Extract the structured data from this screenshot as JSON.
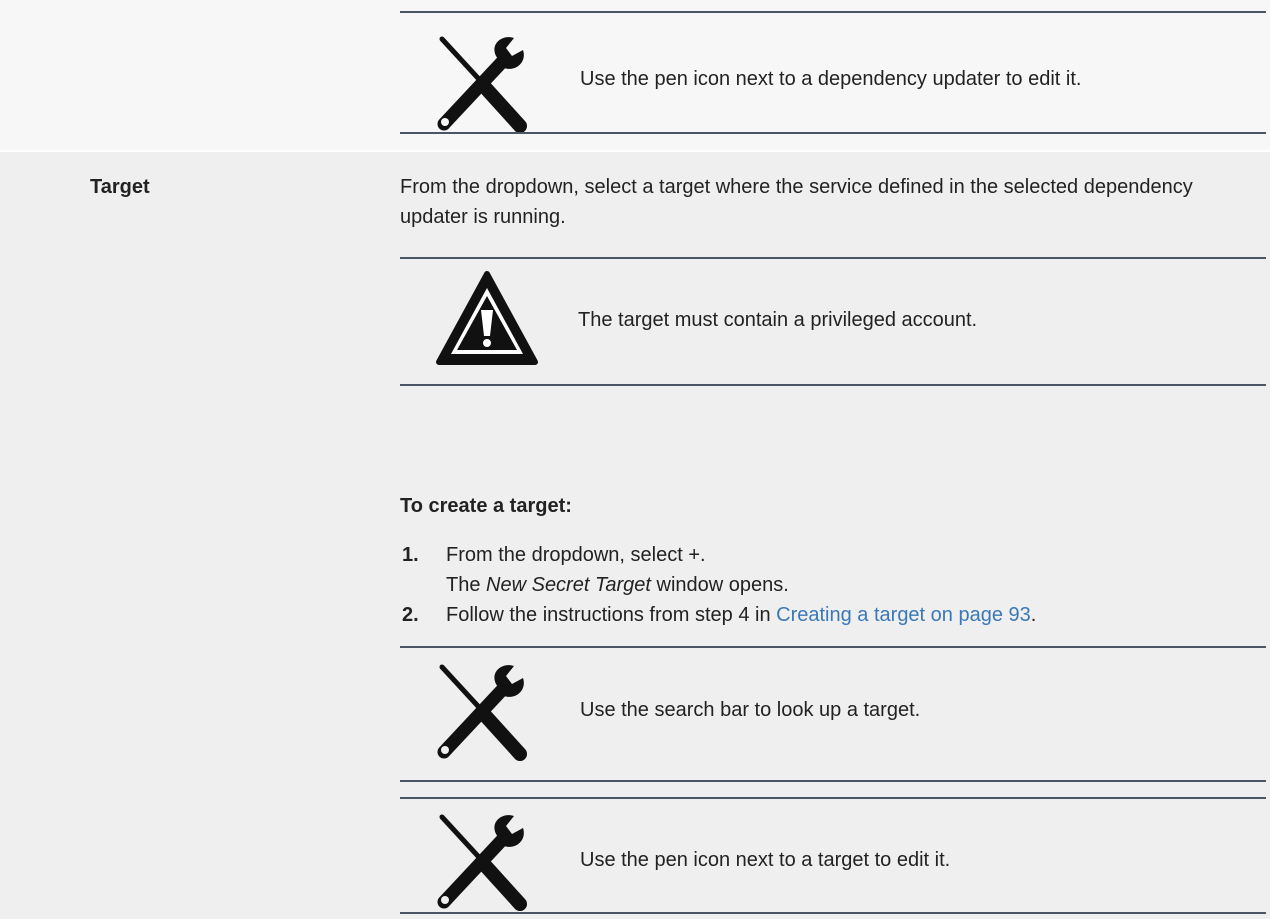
{
  "top_note": {
    "icon": "tools-icon",
    "text": "Use the pen icon next to a dependency updater to edit it."
  },
  "target_row": {
    "label": "Target",
    "description": "From the dropdown, select a target where the service defined in the selected dependency updater is running.",
    "warning": {
      "icon": "warning-icon",
      "text": "The target must contain a privileged account."
    },
    "procedure_heading": "To create a target:",
    "steps": [
      {
        "number": "1.",
        "line1": "From the dropdown, select +.",
        "line2_italic": "New Secret Target",
        "line2_pre": "The ",
        "line2_post": " window opens."
      },
      {
        "number": "2.",
        "text_before": "Follow the instructions from step 4 in ",
        "link_text": "Creating a target on page 93",
        "text_after": "."
      }
    ],
    "tips": [
      {
        "icon": "tools-icon",
        "text": "Use the search bar to look up a target."
      },
      {
        "icon": "tools-icon",
        "text": "Use the pen icon next to a target to edit it."
      }
    ]
  },
  "colors": {
    "link": "#3a78b7",
    "rule": "#4a5663",
    "row_background": "#efefef"
  }
}
